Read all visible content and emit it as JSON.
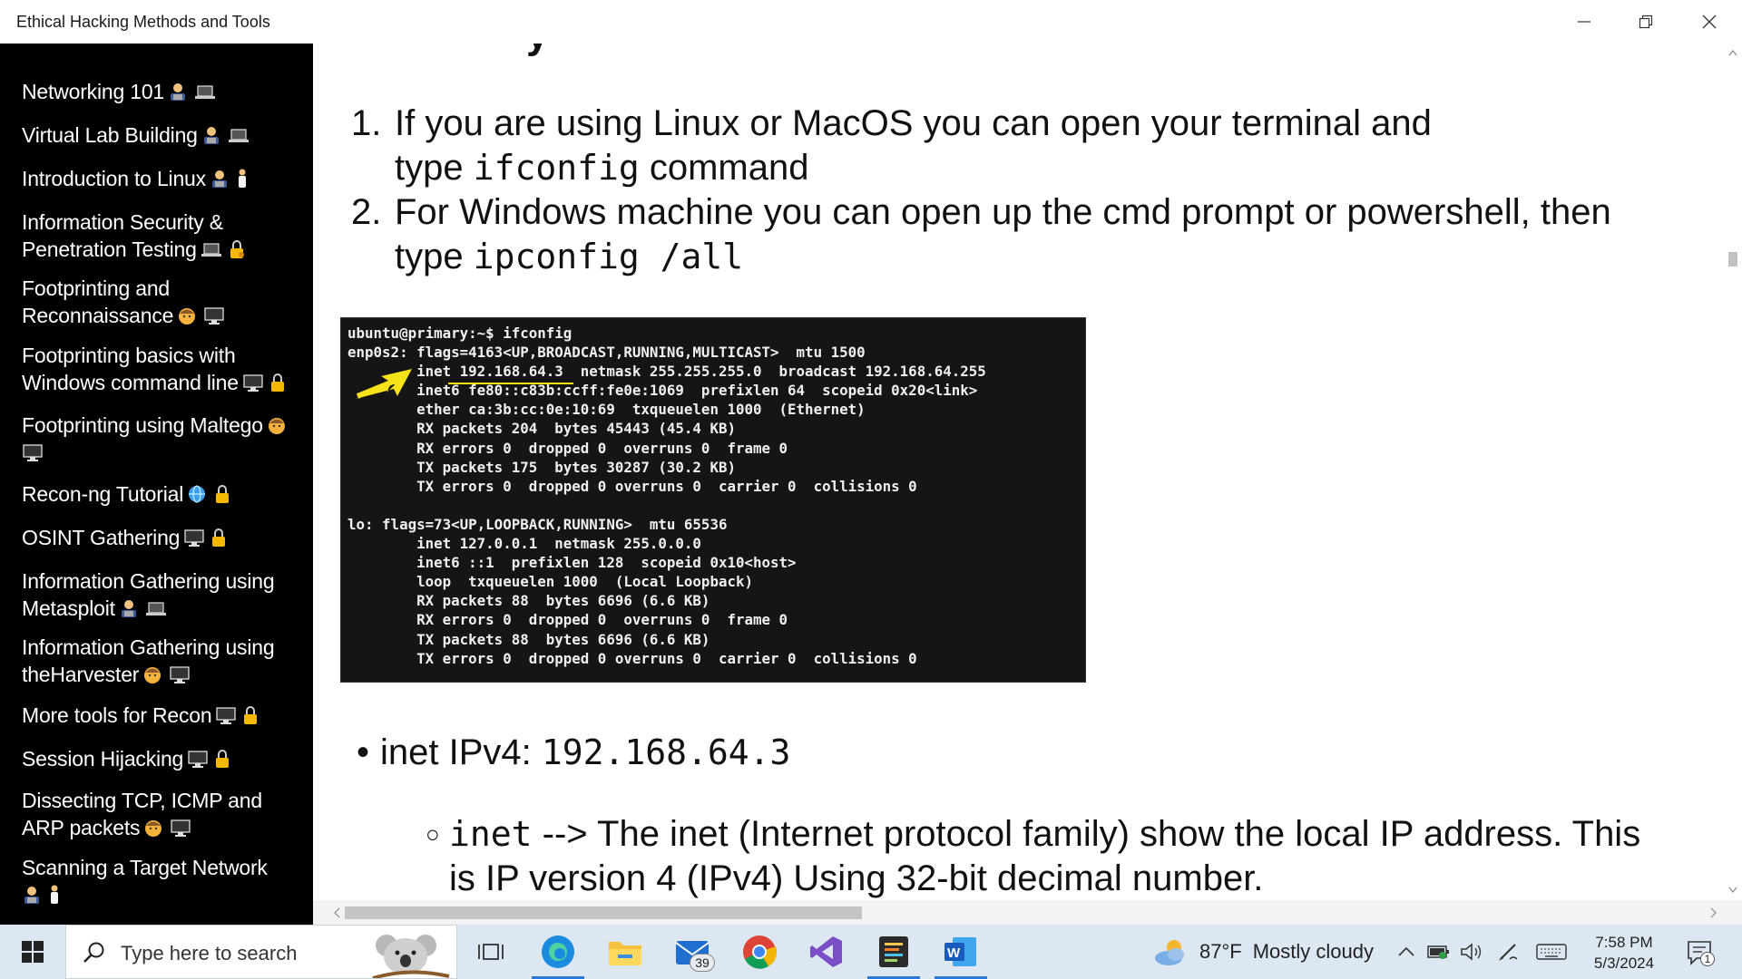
{
  "window": {
    "title": "Ethical Hacking Methods and Tools"
  },
  "sidebar": {
    "items": [
      {
        "line1": "Networking 101",
        "line2": "",
        "emoji": [
          "technologist",
          "laptop"
        ]
      },
      {
        "line1": "Virtual Lab Building",
        "line2": "",
        "emoji": [
          "technologist",
          "laptop"
        ]
      },
      {
        "line1": "Introduction to Linux",
        "line2": "",
        "emoji": [
          "technologist",
          "person"
        ]
      },
      {
        "line1": "Information Security &",
        "line2": "Penetration Testing",
        "emoji": [
          "laptop",
          "lock-key"
        ]
      },
      {
        "line1": "Footprinting and",
        "line2": "Reconnaissance",
        "emoji": [
          "face",
          "desktop"
        ]
      },
      {
        "line1": "Footprinting basics with",
        "line2": "Windows command line",
        "emoji": [
          "desktop",
          "lock"
        ]
      },
      {
        "line1": "Footprinting using Maltego",
        "line2": "",
        "emoji": [
          "face",
          "desktop"
        ]
      },
      {
        "line1": "Recon-ng Tutorial",
        "line2": "",
        "emoji": [
          "globe",
          "lock"
        ]
      },
      {
        "line1": "OSINT Gathering",
        "line2": "",
        "emoji": [
          "desktop",
          "lock"
        ]
      },
      {
        "line1": "Information Gathering using",
        "line2": "Metasploit",
        "emoji": [
          "technologist",
          "laptop"
        ]
      },
      {
        "line1": "Information Gathering using",
        "line2": "theHarvester",
        "emoji": [
          "face",
          "desktop"
        ]
      },
      {
        "line1": "More tools for Recon",
        "line2": "",
        "emoji": [
          "desktop",
          "lock"
        ]
      },
      {
        "line1": "Session Hijacking",
        "line2": "",
        "emoji": [
          "desktop",
          "lock"
        ]
      },
      {
        "line1": "Dissecting TCP, ICMP and",
        "line2": "ARP packets",
        "emoji": [
          "face",
          "desktop"
        ]
      },
      {
        "line1": "Scanning a Target Network",
        "line2": "",
        "emoji": [
          "technologist",
          "person"
        ]
      }
    ]
  },
  "content": {
    "steps": [
      {
        "num": "1.",
        "text1": "If you are using Linux or MacOS you can open your terminal and",
        "pre2": "type ",
        "code": "ifconfig",
        "post2": " command"
      },
      {
        "num": "2.",
        "text1": "For Windows machine you can open up the cmd prompt or powershell, then",
        "pre2": "type ",
        "code": "ipconfig /all",
        "post2": ""
      }
    ],
    "terminal_lines": [
      "ubuntu@primary:~$ ifconfig",
      "enp0s2: flags=4163<UP,BROADCAST,RUNNING,MULTICAST>  mtu 1500",
      "        inet 192.168.64.3  netmask 255.255.255.0  broadcast 192.168.64.255",
      "        inet6 fe80::c83b:ccff:fe0e:1069  prefixlen 64  scopeid 0x20<link>",
      "        ether ca:3b:cc:0e:10:69  txqueuelen 1000  (Ethernet)",
      "        RX packets 204  bytes 45443 (45.4 KB)",
      "        RX errors 0  dropped 0  overruns 0  frame 0",
      "        TX packets 175  bytes 30287 (30.2 KB)",
      "        TX errors 0  dropped 0 overruns 0  carrier 0  collisions 0",
      "",
      "lo: flags=73<UP,LOOPBACK,RUNNING>  mtu 65536",
      "        inet 127.0.0.1  netmask 255.0.0.0",
      "        inet6 ::1  prefixlen 128  scopeid 0x10<host>",
      "        loop  txqueuelen 1000  (Local Loopback)",
      "        RX packets 88  bytes 6696 (6.6 KB)",
      "        RX errors 0  dropped 0  overruns 0  frame 0",
      "        TX packets 88  bytes 6696 (6.6 KB)",
      "        TX errors 0  dropped 0 overruns 0  carrier 0  collisions 0"
    ],
    "bullet_label": "inet IPv4: ",
    "bullet_value": "192.168.64.3",
    "sub_code": "inet",
    "sub_text1": " --> The inet (Internet protocol family) show the local IP address. This",
    "sub_text2": "is IP version 4 (IPv4) Using 32-bit decimal number."
  },
  "taskbar": {
    "search_placeholder": "Type here to search",
    "mail_badge": "39",
    "weather": {
      "temp": "87°F",
      "condition": "Mostly cloudy"
    },
    "clock": {
      "time": "7:58 PM",
      "date": "5/3/2024"
    },
    "notification_count": "1",
    "apps": [
      "task-view",
      "edge",
      "file-explorer",
      "mail",
      "chrome",
      "visual-studio",
      "sublime-text",
      "word"
    ]
  },
  "colors": {
    "sidebar_bg": "#000000",
    "terminal_bg": "#151515",
    "arrow": "#f5e218",
    "taskbar_bg": "#dde7f2",
    "active_indicator": "#2b79d4"
  }
}
